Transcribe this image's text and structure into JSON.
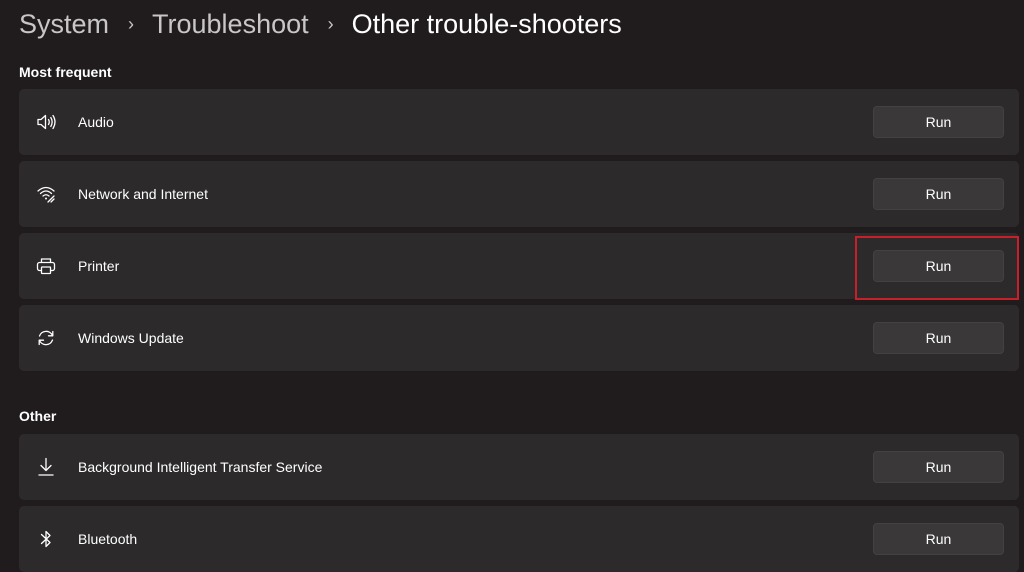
{
  "breadcrumb": {
    "items": [
      "System",
      "Troubleshoot"
    ],
    "separator": "›",
    "current": "Other trouble-shooters"
  },
  "sections": {
    "most_frequent": {
      "heading": "Most frequent",
      "items": [
        {
          "label": "Audio",
          "icon": "speaker-icon",
          "button": "Run"
        },
        {
          "label": "Network and Internet",
          "icon": "wifi-network-icon",
          "button": "Run"
        },
        {
          "label": "Printer",
          "icon": "printer-icon",
          "button": "Run",
          "highlighted": true
        },
        {
          "label": "Windows Update",
          "icon": "sync-icon",
          "button": "Run"
        }
      ]
    },
    "other": {
      "heading": "Other",
      "items": [
        {
          "label": "Background Intelligent Transfer Service",
          "icon": "download-icon",
          "button": "Run"
        },
        {
          "label": "Bluetooth",
          "icon": "bluetooth-icon",
          "button": "Run"
        }
      ]
    }
  },
  "colors": {
    "background": "#201c1d",
    "row_background": "#2c2a2b",
    "button_background": "#3a3839",
    "highlight": "#c8202b"
  }
}
